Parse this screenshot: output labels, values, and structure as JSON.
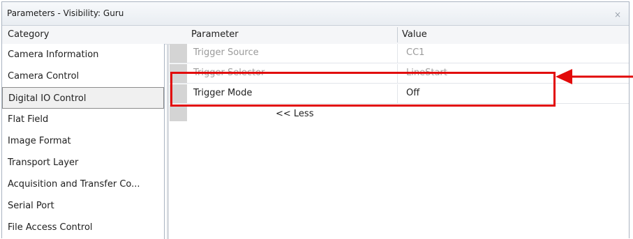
{
  "window": {
    "title": "Parameters - Visibility: Guru",
    "close_glyph": "×"
  },
  "headers": {
    "category": "Category",
    "parameter": "Parameter",
    "value": "Value"
  },
  "categories": [
    {
      "label": "Camera Information"
    },
    {
      "label": "Camera Control"
    },
    {
      "label": "Digital IO Control",
      "selected": true
    },
    {
      "label": "Flat Field"
    },
    {
      "label": "Image Format"
    },
    {
      "label": "Transport Layer"
    },
    {
      "label": "Acquisition and Transfer Co..."
    },
    {
      "label": "Serial Port"
    },
    {
      "label": "File Access Control"
    }
  ],
  "parameters": [
    {
      "name": "Trigger Source",
      "value": "CC1",
      "state": "disabled"
    },
    {
      "name": "Trigger Selector",
      "value": "LineStart",
      "state": "struck"
    },
    {
      "name": "Trigger Mode",
      "value": "Off",
      "state": "normal"
    }
  ],
  "less_link": "<< Less",
  "colors": {
    "annotation_red": "#e20a0a"
  }
}
